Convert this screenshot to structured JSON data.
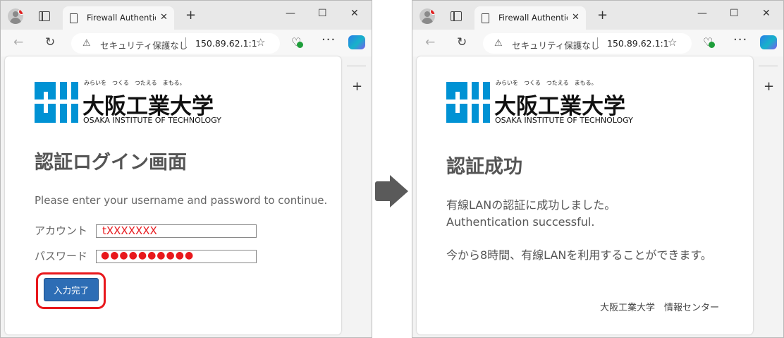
{
  "colors": {
    "accent_blue": "#0092d4",
    "button_blue": "#2d6db5",
    "highlight_red": "#e8181c",
    "arrow_gray": "#5a5a5a"
  },
  "browser": {
    "tab_title": "Firewall Authentic",
    "tab_close": "✕",
    "new_tab": "+",
    "minimize": "—",
    "maximize": "☐",
    "close": "✕",
    "back": "←",
    "reload": "↻",
    "security_label": "セキュリティ保護なし",
    "url": "150.89.62.1:1",
    "more": "···",
    "sidebar_add": "+",
    "warning_icon": "⚠",
    "favorite_icon": "☆",
    "heart_icon": "♡"
  },
  "logo": {
    "slogan": "みらいを　つくる　つたえる　まもる。",
    "name": "大阪工業大学",
    "english": "OSAKA INSTITUTE OF TECHNOLOGY"
  },
  "login": {
    "heading": "認証ログイン画面",
    "instruction": "Please enter your username and password to continue.",
    "account_label": "アカウント",
    "account_value": "tXXXXXXX",
    "password_label": "パスワード",
    "password_value": "●●●●●●●●●●",
    "submit_label": "入力完了"
  },
  "success": {
    "heading": "認証成功",
    "line1": "有線LANの認証に成功しました。",
    "line2": "Authentication successful.",
    "line3": "今から8時間、有線LANを利用することができます。",
    "footer": "大阪工業大学　情報センター"
  }
}
